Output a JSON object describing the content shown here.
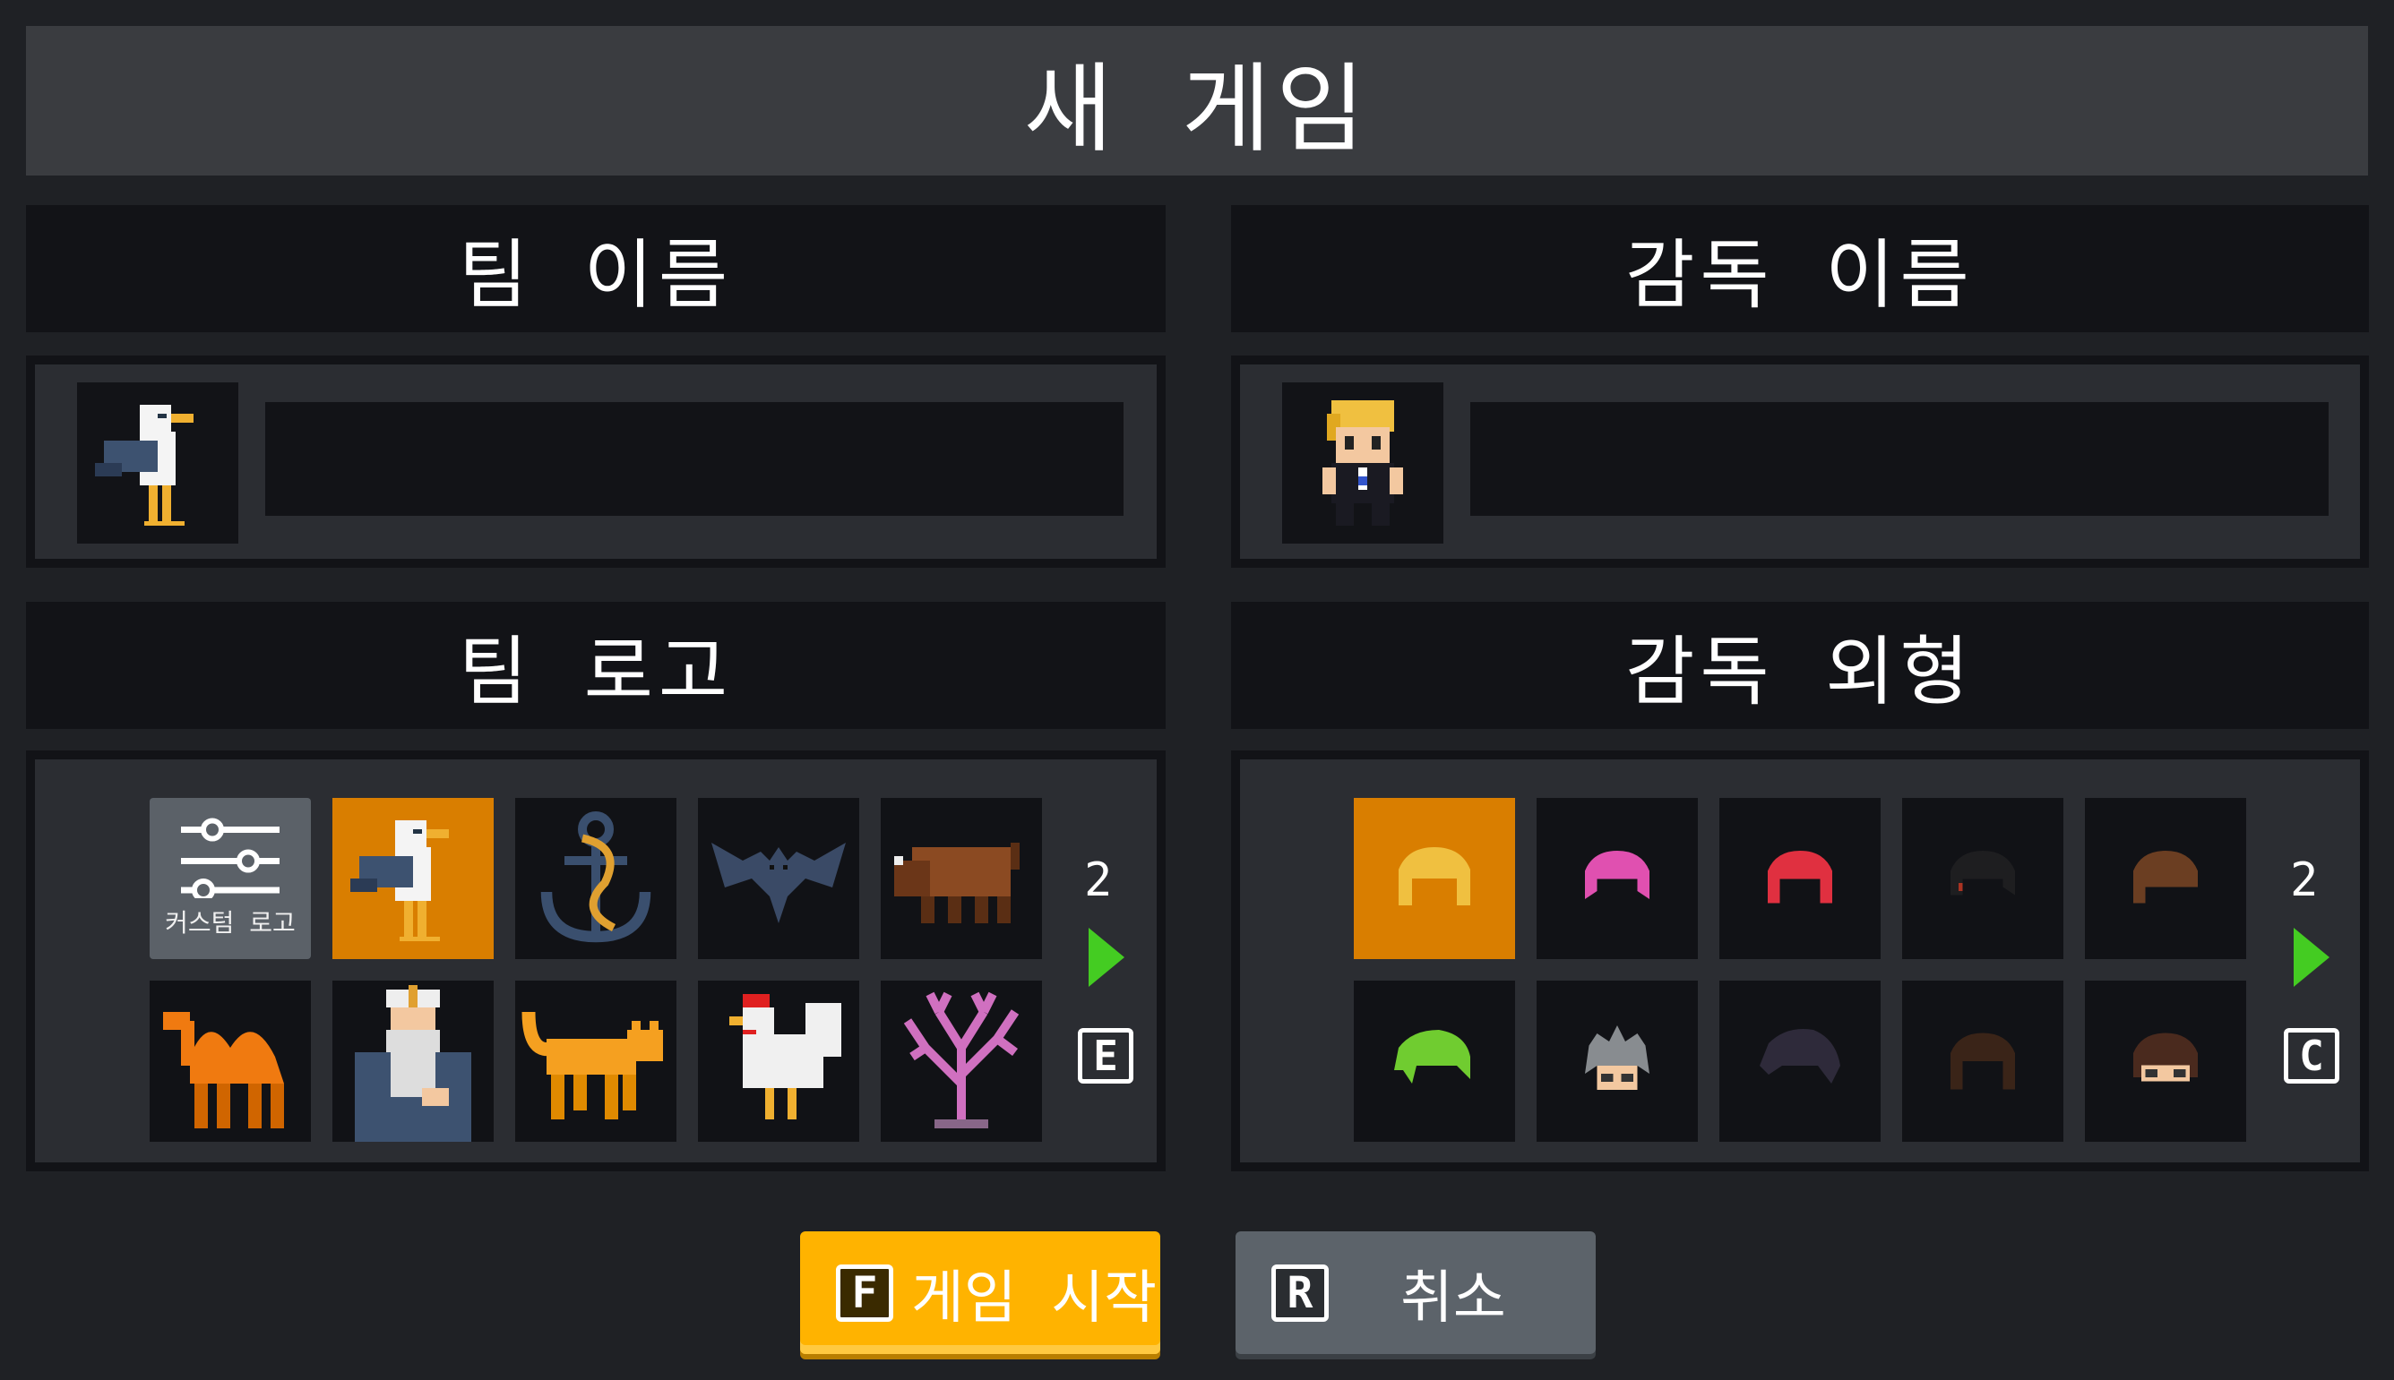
{
  "title": "새 게임",
  "team_name": {
    "header": "팀 이름",
    "input_value": ""
  },
  "manager_name": {
    "header": "감독 이름",
    "input_value": ""
  },
  "team_logo": {
    "header": "팀 로고",
    "custom_label": "커스텀 로고",
    "page": "2",
    "next_key": "E",
    "items": [
      "custom",
      "seagull",
      "anchor",
      "bat",
      "bison",
      "camel",
      "old-captain",
      "cat",
      "rooster",
      "coral"
    ],
    "selected": "seagull"
  },
  "manager_look": {
    "header": "감독 외형",
    "page": "2",
    "next_key": "C",
    "items": [
      "hair-blonde",
      "hair-pink",
      "hair-red",
      "hair-black",
      "hair-brown",
      "hair-green",
      "hair-gray-spiky",
      "hair-dark-purple",
      "hair-dark-brown",
      "hair-brown-bowl"
    ],
    "selected": "hair-blonde"
  },
  "buttons": {
    "start": {
      "key": "F",
      "label": "게임 시작"
    },
    "cancel": {
      "key": "R",
      "label": "취소"
    }
  },
  "colors": {
    "selected": "#d97e00",
    "start_button": "#ffb300",
    "cancel_button": "#5c636a",
    "arrow": "#44cc22"
  }
}
